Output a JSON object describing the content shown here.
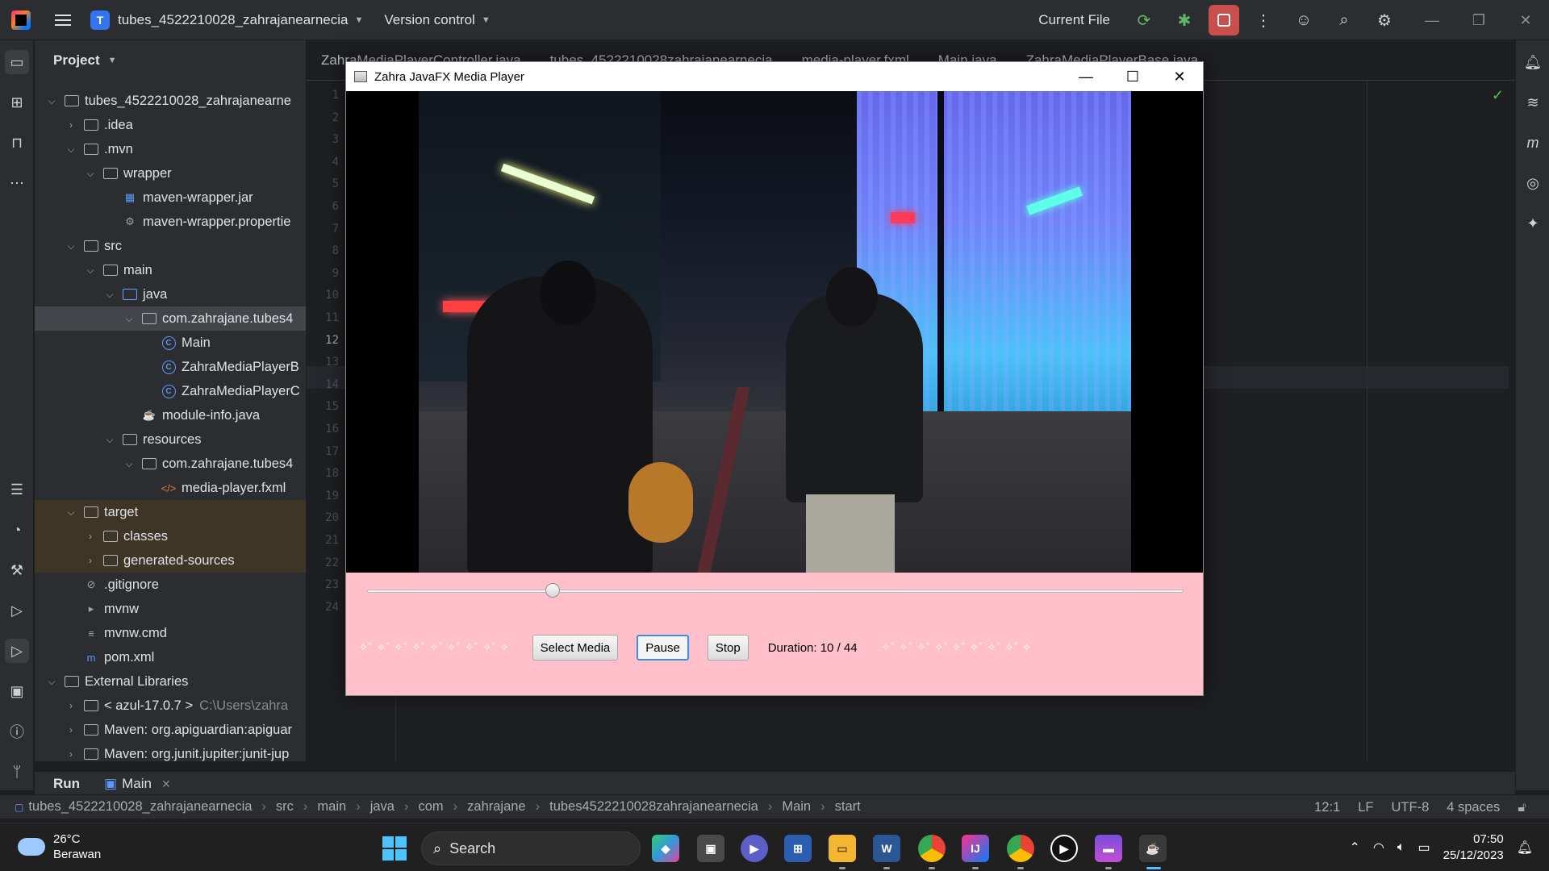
{
  "ide": {
    "project_badge": "T",
    "project_name": "tubes_4522210028_zahrajanearnecia",
    "version_control": "Version control",
    "run_config": "Current File"
  },
  "project_panel": {
    "title": "Project",
    "rows": [
      {
        "label": "tubes_4522210028_zahrajanearne",
        "depth": 0,
        "arrow": "⌄",
        "icon": "folder"
      },
      {
        "label": ".idea",
        "depth": 1,
        "arrow": "›",
        "icon": "folder"
      },
      {
        "label": ".mvn",
        "depth": 1,
        "arrow": "⌄",
        "icon": "folder"
      },
      {
        "label": "wrapper",
        "depth": 2,
        "arrow": "⌄",
        "icon": "folder"
      },
      {
        "label": "maven-wrapper.jar",
        "depth": 3,
        "arrow": "",
        "icon": "jar"
      },
      {
        "label": "maven-wrapper.propertie",
        "depth": 3,
        "arrow": "",
        "icon": "gear"
      },
      {
        "label": "src",
        "depth": 1,
        "arrow": "⌄",
        "icon": "folder"
      },
      {
        "label": "main",
        "depth": 2,
        "arrow": "⌄",
        "icon": "folder"
      },
      {
        "label": "java",
        "depth": 3,
        "arrow": "⌄",
        "icon": "folder-blue"
      },
      {
        "label": "com.zahrajane.tubes4",
        "depth": 4,
        "arrow": "⌄",
        "icon": "package"
      },
      {
        "label": "Main",
        "depth": 5,
        "arrow": "",
        "icon": "class"
      },
      {
        "label": "ZahraMediaPlayerB",
        "depth": 5,
        "arrow": "",
        "icon": "class"
      },
      {
        "label": "ZahraMediaPlayerC",
        "depth": 5,
        "arrow": "",
        "icon": "class"
      },
      {
        "label": "module-info.java",
        "depth": 4,
        "arrow": "",
        "icon": "java"
      },
      {
        "label": "resources",
        "depth": 3,
        "arrow": "⌄",
        "icon": "folder"
      },
      {
        "label": "com.zahrajane.tubes4",
        "depth": 4,
        "arrow": "⌄",
        "icon": "folder"
      },
      {
        "label": "media-player.fxml",
        "depth": 5,
        "arrow": "",
        "icon": "xml"
      },
      {
        "label": "target",
        "depth": 1,
        "arrow": "⌄",
        "icon": "folder"
      },
      {
        "label": "classes",
        "depth": 2,
        "arrow": "›",
        "icon": "folder"
      },
      {
        "label": "generated-sources",
        "depth": 2,
        "arrow": "›",
        "icon": "folder"
      },
      {
        "label": ".gitignore",
        "depth": 1,
        "arrow": "",
        "icon": "ignore"
      },
      {
        "label": "mvnw",
        "depth": 1,
        "arrow": "",
        "icon": "shell"
      },
      {
        "label": "mvnw.cmd",
        "depth": 1,
        "arrow": "",
        "icon": "text"
      },
      {
        "label": "pom.xml",
        "depth": 1,
        "arrow": "",
        "icon": "maven"
      },
      {
        "label": "External Libraries",
        "depth": 0,
        "arrow": "⌄",
        "icon": "library"
      },
      {
        "label": "< azul-17.0.7 >",
        "sub": "C:\\Users\\zahra",
        "depth": 1,
        "arrow": "›",
        "icon": "folder"
      },
      {
        "label": "Maven: org.apiguardian:apiguar",
        "depth": 1,
        "arrow": "›",
        "icon": "folder"
      },
      {
        "label": "Maven: org.junit.jupiter:junit-jup",
        "depth": 1,
        "arrow": "›",
        "icon": "folder"
      }
    ]
  },
  "editor": {
    "tabs": [
      "ZahraMediaPlayerController.java",
      "tubes_4522210028zahrajanearnecia",
      "media-player.fxml",
      "Main.java",
      "ZahraMediaPlayerBase.java"
    ],
    "line_numbers": [
      "1",
      "2",
      "3",
      "4",
      "5",
      "6",
      "7",
      "8",
      "9",
      "10",
      "11",
      "12",
      "13",
      "14",
      "15",
      "16",
      "17",
      "18",
      "19",
      "20",
      "21",
      "22",
      "23",
      "24"
    ],
    "current_line": "12"
  },
  "run_panel": {
    "label": "Run",
    "config": "Main"
  },
  "status_bar": {
    "breadcrumbs": [
      "tubes_4522210028_zahrajanearnecia",
      "src",
      "main",
      "java",
      "com",
      "zahrajane",
      "tubes4522210028zahrajanearnecia",
      "Main",
      "start"
    ],
    "position": "12:1",
    "line_ending": "LF",
    "encoding": "UTF-8",
    "indent": "4 spaces"
  },
  "media_player": {
    "window_title": "Zahra JavaFX Media Player",
    "progress": 0.2273,
    "decor_left": "✧˚ ✧˚ ✧˚ ✧˚ ✧˚ ✧˚ ✧˚ ✧˚ ✧",
    "decor_right": "✧˚ ✧˚ ✧˚ ✧˚ ✧˚ ✧˚ ✧˚ ✧˚ ✧",
    "select_label": "Select Media",
    "pause_label": "Pause",
    "stop_label": "Stop",
    "duration_text": "Duration: 10 / 44"
  },
  "taskbar": {
    "temperature": "26°C",
    "weather": "Berawan",
    "search_label": "Search",
    "time": "07:50",
    "date": "25/12/2023"
  },
  "colors": {
    "accent": "#3574f0",
    "player_bg": "#ffc0cb",
    "stop_red": "#c94f4f"
  }
}
